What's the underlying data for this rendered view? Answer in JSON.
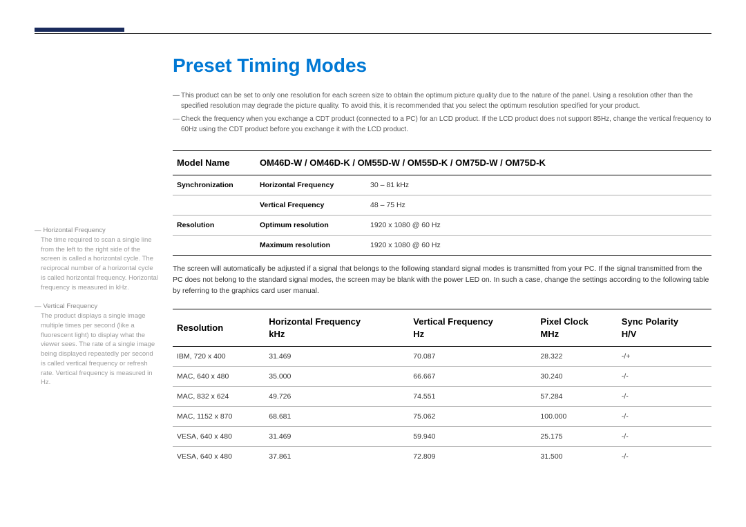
{
  "title": "Preset Timing Modes",
  "notes": [
    "This product can be set to only one resolution for each screen size to obtain the optimum picture quality due to the nature of the panel. Using a resolution other than the specified resolution may degrade the picture quality. To avoid this, it is recommended that you select the optimum resolution specified for your product.",
    "Check the frequency when you exchange a CDT product (connected to a PC) for an LCD product. If the LCD product does not support 85Hz, change the vertical frequency to 60Hz using the CDT product before you exchange it with the LCD product."
  ],
  "spec": {
    "model_label": "Model Name",
    "model_value": "OM46D-W / OM46D-K / OM55D-W / OM55D-K / OM75D-W / OM75D-K",
    "sync_label": "Synchronization",
    "hfreq_label": "Horizontal Frequency",
    "hfreq_value": "30 – 81 kHz",
    "vfreq_label": "Vertical Frequency",
    "vfreq_value": "48 – 75 Hz",
    "res_label": "Resolution",
    "optres_label": "Optimum resolution",
    "optres_value": "1920 x 1080 @ 60 Hz",
    "maxres_label": "Maximum resolution",
    "maxres_value": "1920 x 1080 @ 60 Hz"
  },
  "mid_text": "The screen will automatically be adjusted if a signal that belongs to the following standard signal modes is transmitted from your PC. If the signal transmitted from the PC does not belong to the standard signal modes, the screen may be blank with the power LED on. In such a case, change the settings according to the following table by referring to the graphics card user manual.",
  "timing_headers": {
    "res": "Resolution",
    "hfreq_a": "Horizontal Frequency",
    "hfreq_b": "kHz",
    "vfreq_a": "Vertical Frequency",
    "vfreq_b": "Hz",
    "pclk_a": "Pixel Clock",
    "pclk_b": "MHz",
    "sync_a": "Sync Polarity",
    "sync_b": "H/V"
  },
  "timing_rows": [
    {
      "res": "IBM, 720 x 400",
      "hf": "31.469",
      "vf": "70.087",
      "pc": "28.322",
      "sp": "-/+"
    },
    {
      "res": "MAC, 640 x 480",
      "hf": "35.000",
      "vf": "66.667",
      "pc": "30.240",
      "sp": "-/-"
    },
    {
      "res": "MAC, 832 x 624",
      "hf": "49.726",
      "vf": "74.551",
      "pc": "57.284",
      "sp": "-/-"
    },
    {
      "res": "MAC, 1152 x 870",
      "hf": "68.681",
      "vf": "75.062",
      "pc": "100.000",
      "sp": "-/-"
    },
    {
      "res": "VESA, 640 x 480",
      "hf": "31.469",
      "vf": "59.940",
      "pc": "25.175",
      "sp": "-/-"
    },
    {
      "res": "VESA, 640 x 480",
      "hf": "37.861",
      "vf": "72.809",
      "pc": "31.500",
      "sp": "-/-"
    }
  ],
  "sidebar": {
    "hf_title": "Horizontal Frequency",
    "hf_body": "The time required to scan a single line from the left to the right side of the screen is called a horizontal cycle. The reciprocal number of a horizontal cycle is called horizontal frequency. Horizontal frequency is measured in kHz.",
    "vf_title": "Vertical Frequency",
    "vf_body": "The product displays a single image multiple times per second (like a fluorescent light) to display what the viewer sees. The rate of a single image being displayed repeatedly per second is called vertical frequency or refresh rate. Vertical frequency is measured in Hz."
  }
}
